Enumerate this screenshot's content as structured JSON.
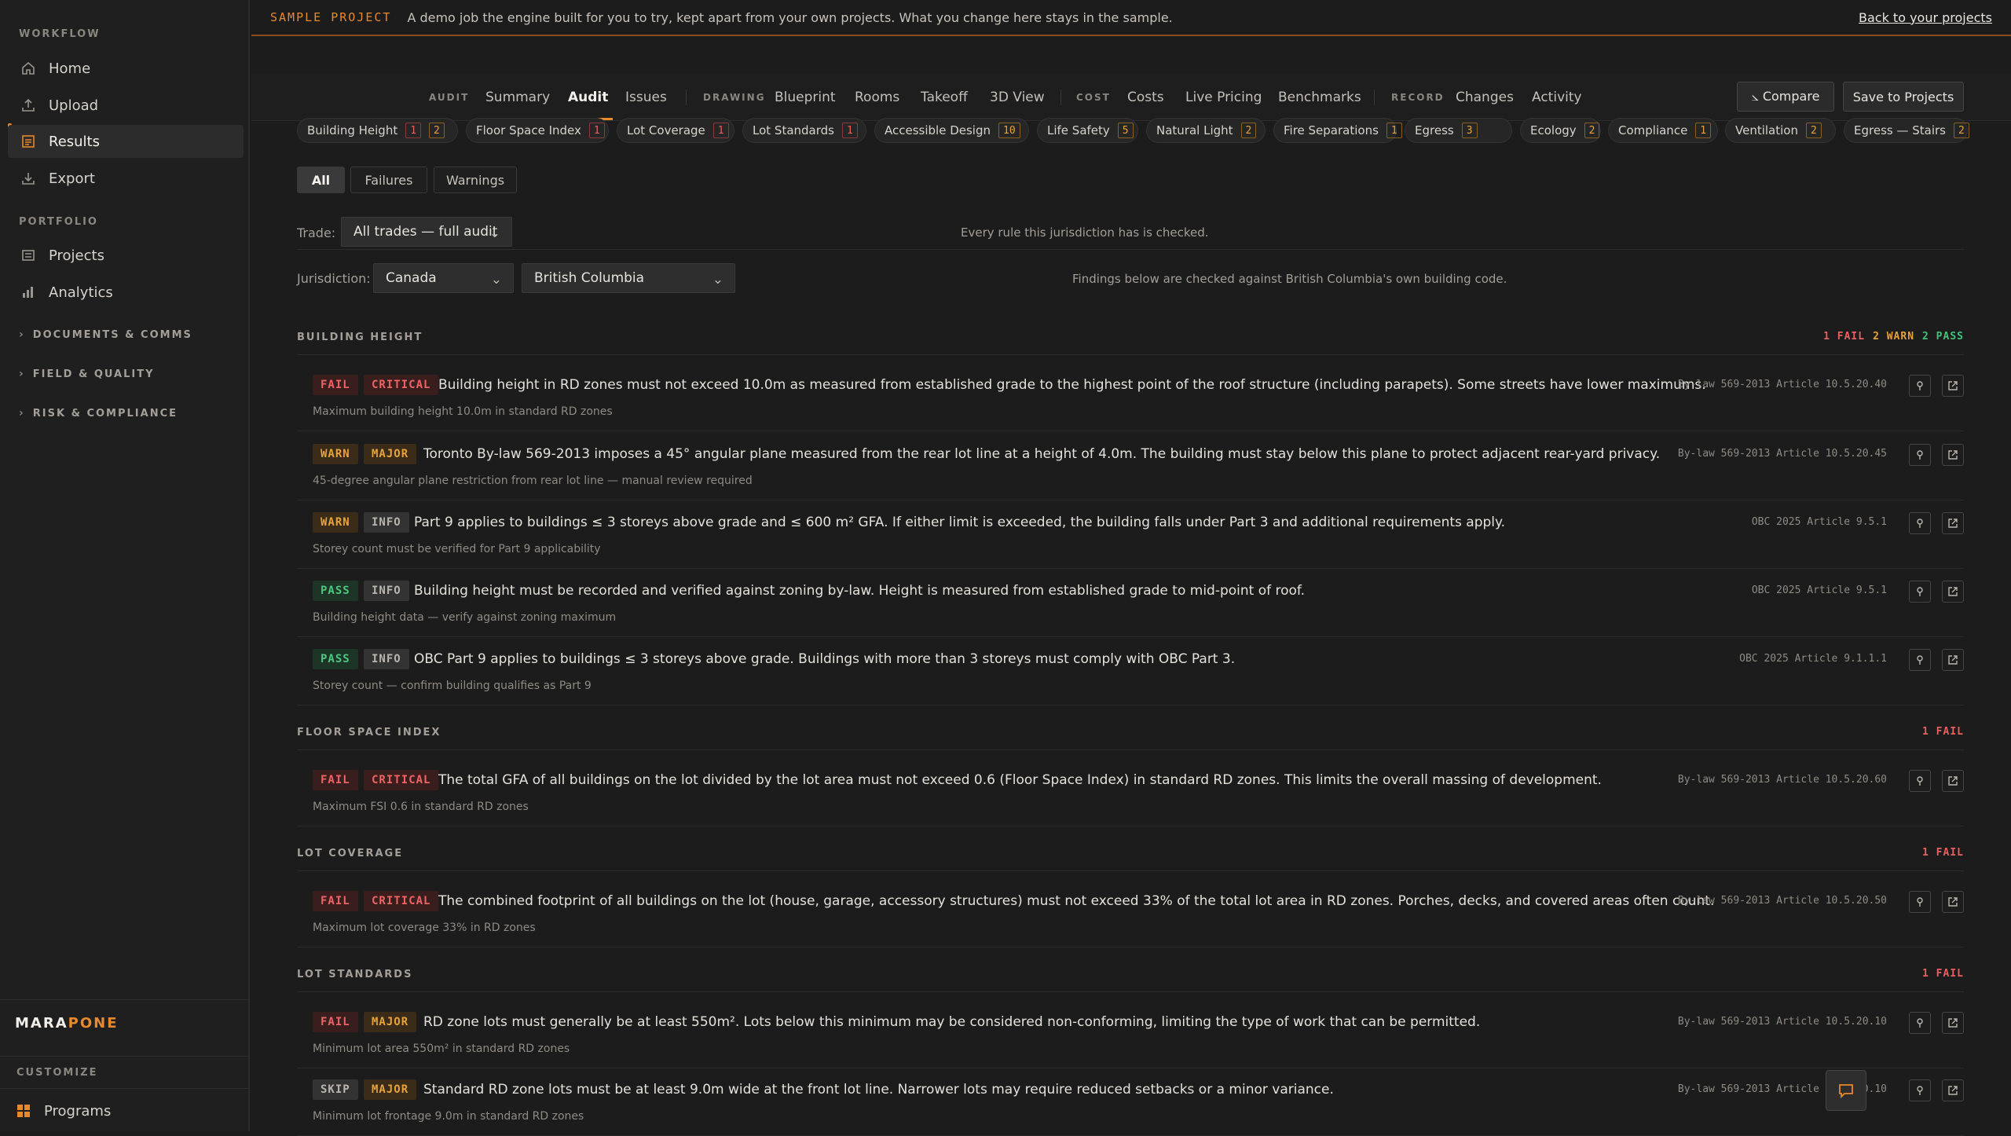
{
  "sidebar": {
    "workflow_label": "WORKFLOW",
    "workflow": [
      {
        "label": "Home",
        "icon": "home-icon"
      },
      {
        "label": "Upload",
        "icon": "upload-icon"
      },
      {
        "label": "Results",
        "icon": "results-icon"
      },
      {
        "label": "Export",
        "icon": "export-icon"
      }
    ],
    "portfolio_label": "PORTFOLIO",
    "portfolio": [
      {
        "label": "Projects",
        "icon": "projects-icon"
      },
      {
        "label": "Analytics",
        "icon": "analytics-icon"
      }
    ],
    "groups": [
      "DOCUMENTS & COMMS",
      "FIELD & QUALITY",
      "RISK & COMPLIANCE"
    ],
    "logo_a": "MARA",
    "logo_b": "PONE",
    "customize_label": "CUSTOMIZE",
    "programs_label": "Programs"
  },
  "banner": {
    "tag": "SAMPLE PROJECT",
    "message": "A demo job the engine built for you to try, kept apart from your own projects. What you change here stays in the sample.",
    "back_link": "Back to your projects"
  },
  "topnav": {
    "audit_group": "AUDIT",
    "summary": "Summary",
    "audit": "Audit",
    "issues": "Issues",
    "drawing_group": "DRAWING",
    "blueprint": "Blueprint",
    "rooms": "Rooms",
    "takeoff": "Takeoff",
    "view3d": "3D View",
    "cost_group": "COST",
    "costs": "Costs",
    "live_pricing": "Live Pricing",
    "benchmarks": "Benchmarks",
    "record_group": "RECORD",
    "changes": "Changes",
    "activity": "Activity",
    "compare": "⦣ Compare",
    "save": "Save to Projects"
  },
  "chips": [
    {
      "label": "Building Height",
      "counts": [
        "1",
        "2"
      ],
      "kinds": [
        "f",
        "w"
      ]
    },
    {
      "label": "Floor Space Index",
      "counts": [
        "1"
      ],
      "kinds": [
        "f"
      ]
    },
    {
      "label": "Lot Coverage",
      "counts": [
        "1"
      ],
      "kinds": [
        "f"
      ]
    },
    {
      "label": "Lot Standards",
      "counts": [
        "1"
      ],
      "kinds": [
        "f"
      ]
    },
    {
      "label": "Accessible Design",
      "counts": [
        "10"
      ],
      "kinds": [
        "w"
      ]
    },
    {
      "label": "Life Safety",
      "counts": [
        "5"
      ],
      "kinds": [
        "w"
      ]
    },
    {
      "label": "Natural Light",
      "counts": [
        "2"
      ],
      "kinds": [
        "w"
      ]
    },
    {
      "label": "Fire Separations",
      "counts": [
        "1"
      ],
      "kinds": [
        "w"
      ]
    },
    {
      "label": "Egress",
      "counts": [
        "3"
      ],
      "kinds": [
        "w"
      ]
    },
    {
      "label": "Ecology",
      "counts": [
        "2"
      ],
      "kinds": [
        "w"
      ]
    },
    {
      "label": "Compliance",
      "counts": [
        "1"
      ],
      "kinds": [
        "w"
      ]
    },
    {
      "label": "Ventilation",
      "counts": [
        "2"
      ],
      "kinds": [
        "w"
      ]
    },
    {
      "label": "Egress — Stairs",
      "counts": [
        "2"
      ],
      "kinds": [
        "w"
      ]
    }
  ],
  "filters": {
    "all": "All",
    "failures": "Failures",
    "warnings": "Warnings"
  },
  "trade": {
    "label": "Trade:",
    "value": "All trades — full audit",
    "note": "Every rule this jurisdiction has is checked."
  },
  "jurisdiction": {
    "label": "Jurisdiction:",
    "country": "Canada",
    "region": "British Columbia",
    "note": "Findings below are checked against British Columbia's own building code."
  },
  "sections": [
    {
      "title": "BUILDING HEIGHT",
      "counts": [
        {
          "t": "1 FAIL",
          "k": "f"
        },
        {
          "t": "2 WARN",
          "k": "w"
        },
        {
          "t": "2 PASS",
          "k": "p"
        }
      ],
      "rows": [
        {
          "status": "FAIL",
          "severity": "CRITICAL",
          "text": "Building height in RD zones must not exceed 10.0m as measured from established grade to the highest point of the roof structure (including parapets). Some streets have lower maximums.",
          "sub": "Maximum building height 10.0m in standard RD zones",
          "ref": "By-law 569-2013 Article 10.5.20.40"
        },
        {
          "status": "WARN",
          "severity": "MAJOR",
          "text": "Toronto By-law 569-2013 imposes a 45° angular plane measured from the rear lot line at a height of 4.0m. The building must stay below this plane to protect adjacent rear-yard privacy.",
          "sub": "45-degree angular plane restriction from rear lot line — manual review required",
          "ref": "By-law 569-2013 Article 10.5.20.45"
        },
        {
          "status": "WARN",
          "severity": "INFO",
          "text": "Part 9 applies to buildings ≤ 3 storeys above grade and ≤ 600 m² GFA. If either limit is exceeded, the building falls under Part 3 and additional requirements apply.",
          "sub": "Storey count must be verified for Part 9 applicability",
          "ref": "OBC 2025 Article 9.5.1"
        },
        {
          "status": "PASS",
          "severity": "INFO",
          "text": "Building height must be recorded and verified against zoning by-law. Height is measured from established grade to mid-point of roof.",
          "sub": "Building height data — verify against zoning maximum",
          "ref": "OBC 2025 Article 9.5.1"
        },
        {
          "status": "PASS",
          "severity": "INFO",
          "text": "OBC Part 9 applies to buildings ≤ 3 storeys above grade. Buildings with more than 3 storeys must comply with OBC Part 3.",
          "sub": "Storey count — confirm building qualifies as Part 9",
          "ref": "OBC 2025 Article 9.1.1.1"
        }
      ]
    },
    {
      "title": "FLOOR SPACE INDEX",
      "counts": [
        {
          "t": "1 FAIL",
          "k": "f"
        }
      ],
      "rows": [
        {
          "status": "FAIL",
          "severity": "CRITICAL",
          "text": "The total GFA of all buildings on the lot divided by the lot area must not exceed 0.6 (Floor Space Index) in standard RD zones. This limits the overall massing of development.",
          "sub": "Maximum FSI 0.6 in standard RD zones",
          "ref": "By-law 569-2013 Article 10.5.20.60"
        }
      ]
    },
    {
      "title": "LOT COVERAGE",
      "counts": [
        {
          "t": "1 FAIL",
          "k": "f"
        }
      ],
      "rows": [
        {
          "status": "FAIL",
          "severity": "CRITICAL",
          "text": "The combined footprint of all buildings on the lot (house, garage, accessory structures) must not exceed 33% of the total lot area in RD zones. Porches, decks, and covered areas often count.",
          "sub": "Maximum lot coverage 33% in RD zones",
          "ref": "By-law 569-2013 Article 10.5.20.50"
        }
      ]
    },
    {
      "title": "LOT STANDARDS",
      "counts": [
        {
          "t": "1 FAIL",
          "k": "f"
        }
      ],
      "rows": [
        {
          "status": "FAIL",
          "severity": "MAJOR",
          "text": "RD zone lots must generally be at least 550m². Lots below this minimum may be considered non-conforming, limiting the type of work that can be permitted.",
          "sub": "Minimum lot area 550m² in standard RD zones",
          "ref": "By-law 569-2013 Article 10.5.20.10"
        },
        {
          "status": "SKIP",
          "severity": "MAJOR",
          "text": "Standard RD zone lots must be at least 9.0m wide at the front lot line. Narrower lots may require reduced setbacks or a minor variance.",
          "sub": "Minimum lot frontage 9.0m in standard RD zones",
          "ref": "By-law 569-2013 Article 10.5.20.10"
        }
      ]
    }
  ]
}
